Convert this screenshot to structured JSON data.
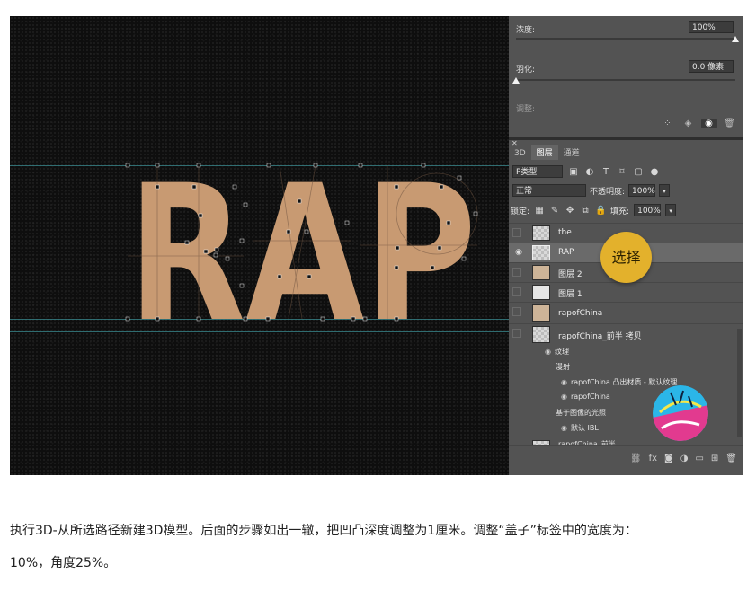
{
  "canvas": {
    "big_text": "RAP",
    "text_color": "#c89a72",
    "guide_color": "#3b8c92"
  },
  "properties": {
    "density_label": "浓度:",
    "density_value": "100%",
    "density_level_percent": 100,
    "feather_label": "羽化:",
    "feather_value": "0.0 像素",
    "feather_level_percent": 0,
    "refine_label": "调整:"
  },
  "layers_panel": {
    "tabs": [
      "3D",
      "图层",
      "通道"
    ],
    "active_tab": "图层",
    "kind_label": "P类型",
    "blend_mode": "正常",
    "opacity_label": "不透明度:",
    "opacity_value": "100%",
    "lock_label": "锁定:",
    "fill_label": "填充:",
    "fill_value": "100%",
    "layers": [
      {
        "name": "the",
        "visible": false,
        "selected": false
      },
      {
        "name": "RAP",
        "visible": true,
        "selected": true
      },
      {
        "name": "图层 2",
        "visible": false,
        "selected": false
      },
      {
        "name": "图层 1",
        "visible": false,
        "selected": false
      },
      {
        "name": "rapofChina",
        "visible": false,
        "selected": false
      },
      {
        "name": "rapofChina_前半 拷贝",
        "visible": false,
        "selected": false
      }
    ],
    "sublayers": {
      "texture": "纹理",
      "diffuse": "漫射",
      "material": "rapofChina 凸出材质 - 默认纹理",
      "rapofchina": "rapofChina",
      "ibl_group": "基于图像的光照",
      "ibl": "默认 IBL",
      "partial": "rapofChina_前半"
    },
    "annotation": "选择",
    "annotation_color": "#e3b12c"
  },
  "caption": {
    "line1": "执行3D-从所选路径新建3D模型。后面的步骤如出一辙，把凹凸深度调整为1厘米。调整“盖子”标签中的宽度为：",
    "line2": "10%，角度25%。"
  }
}
